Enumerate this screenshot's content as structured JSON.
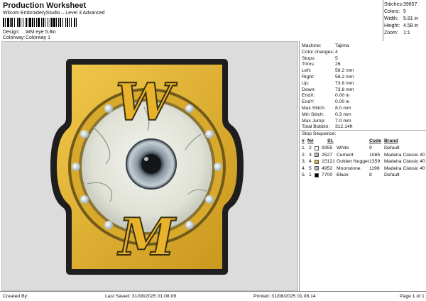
{
  "header": {
    "title": "Production Worksheet",
    "subtitle": "Wilcom EmbroideryStudio – Level 3 Advanced",
    "design_label": "Design:",
    "design_value": "WM eye 5.8in",
    "colorway_label": "Colorway:",
    "colorway_value": "Colorway 1"
  },
  "stats": [
    {
      "label": "Stitches:",
      "value": "39657"
    },
    {
      "label": "Colors:",
      "value": "5"
    },
    {
      "label": "Width:",
      "value": "5.81 in"
    },
    {
      "label": "Height:",
      "value": "4.58 in"
    },
    {
      "label": "Zoom:",
      "value": "1:1"
    }
  ],
  "machine_info": [
    {
      "label": "Machine:",
      "value": "Tajima"
    },
    {
      "label": "Color changes:",
      "value": "4"
    },
    {
      "label": "Stops:",
      "value": "5"
    },
    {
      "label": "Trims:",
      "value": "26"
    },
    {
      "label": "Left:",
      "value": "58.2 mm"
    },
    {
      "label": "Right:",
      "value": "58.2 mm"
    },
    {
      "label": "Up:",
      "value": "73.8 mm"
    },
    {
      "label": "Down:",
      "value": "73.8 mm"
    },
    {
      "label": "EndX:",
      "value": "0.00 in"
    },
    {
      "label": "EndY:",
      "value": "0.00 in"
    },
    {
      "label": "Max Stitch:",
      "value": "8.0 mm"
    },
    {
      "label": "Min Stitch:",
      "value": "0.3 mm"
    },
    {
      "label": "Max Jump:",
      "value": "7.0 mm"
    },
    {
      "label": "Total Bobbin:",
      "value": "312.14ft"
    }
  ],
  "stop_sequence": {
    "title": "Stop Sequence:",
    "columns": {
      "num": "#",
      "n": "N#",
      "st": "St.",
      "name": "",
      "code": "Code",
      "brand": "Brand"
    },
    "rows": [
      {
        "num": "1.",
        "n": "2",
        "color": "#ffffff",
        "st": "9355",
        "name": "White",
        "code": "9",
        "brand": "Default"
      },
      {
        "num": "2.",
        "n": "3",
        "color": "#b9b9b0",
        "st": "2527",
        "name": "Cement",
        "code": "1085",
        "brand": "Madeira Classic 40"
      },
      {
        "num": "3.",
        "n": "4",
        "color": "#e8b32a",
        "st": "15121",
        "name": "Golden Nugget",
        "code": "1359",
        "brand": "Madeira Classic 40"
      },
      {
        "num": "4.",
        "n": "5",
        "color": "#a9b6bb",
        "st": "4952",
        "name": "Moonstone",
        "code": "1198",
        "brand": "Madeira Classic 40"
      },
      {
        "num": "5.",
        "n": "1",
        "color": "#000000",
        "st": "7700",
        "name": "Black",
        "code": "8",
        "brand": "Default"
      }
    ]
  },
  "footer": {
    "created_by": "Created By:",
    "last_saved": "Last Saved: 31/08/2025 01.08.09",
    "printed": "Printed: 31/08/2025 01.08.14",
    "page": "Page 1 of 1"
  },
  "design_letters": {
    "top": "W",
    "bottom": "M"
  }
}
